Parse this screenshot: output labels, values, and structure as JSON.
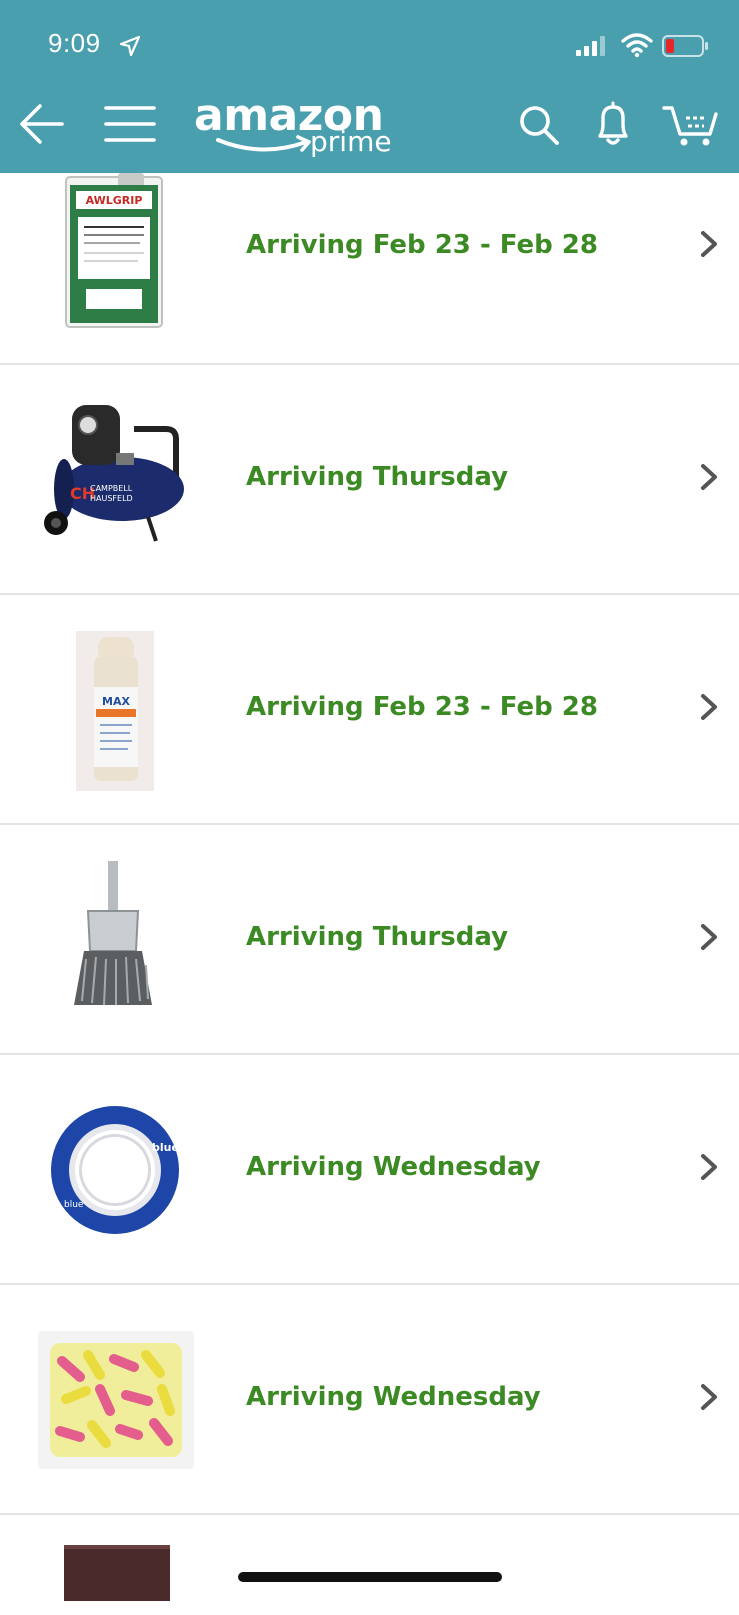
{
  "status_bar": {
    "time": "9:09",
    "icons": [
      "location-arrow-icon",
      "cellular-signal-icon",
      "wifi-icon",
      "battery-low-icon"
    ]
  },
  "header": {
    "logo_word": "amazon",
    "logo_sub": "prime",
    "icons": [
      "back-arrow-icon",
      "menu-icon",
      "search-icon",
      "bell-icon",
      "cart-icon"
    ],
    "colors": {
      "background": "#4a9fae",
      "foreground": "#ffffff"
    }
  },
  "orders": [
    {
      "product_image": "awlgrip-reducer-can",
      "arrival": "Arriving Feb 23 - Feb 28"
    },
    {
      "product_image": "campbell-hausfeld-air-compressor",
      "arrival": "Arriving Thursday"
    },
    {
      "product_image": "spray-can",
      "arrival": "Arriving Feb 23 - Feb 28"
    },
    {
      "product_image": "wire-end-brush",
      "arrival": "Arriving Thursday"
    },
    {
      "product_image": "blue-painters-tape",
      "arrival": "Arriving Wednesday"
    },
    {
      "product_image": "foam-earplugs-bag",
      "arrival": "Arriving Wednesday"
    },
    {
      "product_image": "abrasive-pad",
      "arrival": ""
    }
  ],
  "colors": {
    "arrival_text": "#3c8a23",
    "divider": "#e4e4e4",
    "chevron": "#555555"
  }
}
